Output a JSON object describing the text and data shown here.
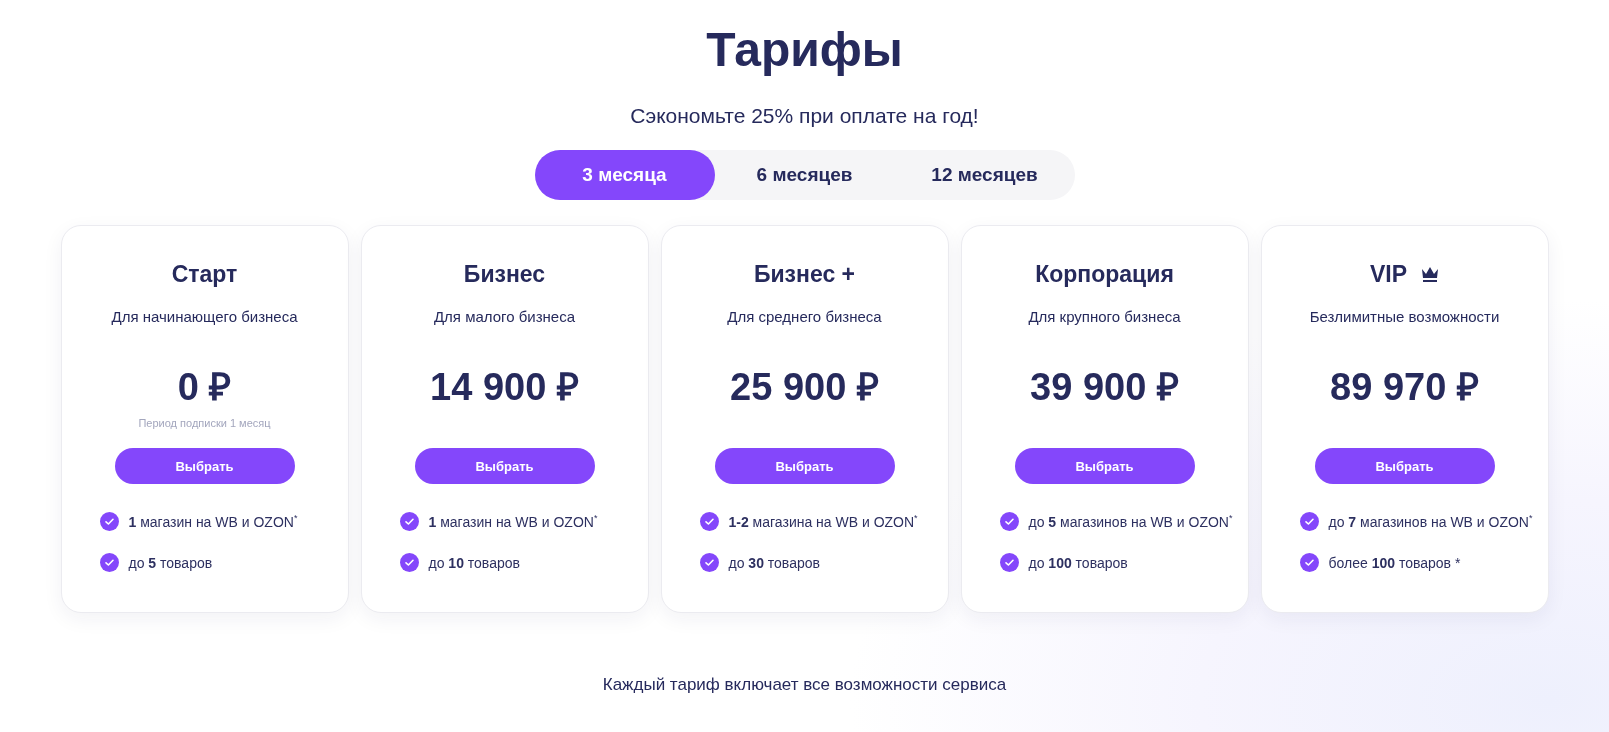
{
  "title": "Тарифы",
  "subtitle": "Сэкономьте 25% при оплате на год!",
  "periods": [
    {
      "label": "3 месяца",
      "selected": true
    },
    {
      "label": "6 месяцев",
      "selected": false
    },
    {
      "label": "12 месяцев",
      "selected": false
    }
  ],
  "plans": [
    {
      "name": "Старт",
      "crowned": false,
      "audience": "Для начинающего бизнеса",
      "price": "0 ₽",
      "note": "Период подписки 1 месяц",
      "button": "Выбрать",
      "features": [
        "**1** магазин на WB и OZON$^{*}$",
        "до **5** товаров"
      ]
    },
    {
      "name": "Бизнес",
      "crowned": false,
      "audience": "Для малого бизнеса",
      "price": "14 900 ₽",
      "button": "Выбрать",
      "features": [
        "**1** магазин на WB и OZON$^{*}$",
        "до **10** товаров"
      ]
    },
    {
      "name": "Бизнес +",
      "crowned": false,
      "audience": "Для среднего бизнеса",
      "price": "25 900 ₽",
      "button": "Выбрать",
      "features": [
        "**1-2** магазина на WB и OZON$^{*}$",
        "до **30** товаров"
      ]
    },
    {
      "name": "Корпорация",
      "crowned": false,
      "audience": "Для крупного бизнеса",
      "price": "39 900 ₽",
      "button": "Выбрать",
      "features": [
        "до **5** магазинов на WB и OZON$^{*}$",
        "до **100** товаров"
      ]
    },
    {
      "name": "VIP",
      "crowned": true,
      "audience": "Безлимитные возможности",
      "price": "89 970 ₽",
      "button": "Выбрать",
      "features": [
        "до **7** магазинов на WB и OZON$^{*}$",
        "более **100** товаров *"
      ]
    }
  ],
  "footer": "Каждый тариф включает все возможности сервиса"
}
